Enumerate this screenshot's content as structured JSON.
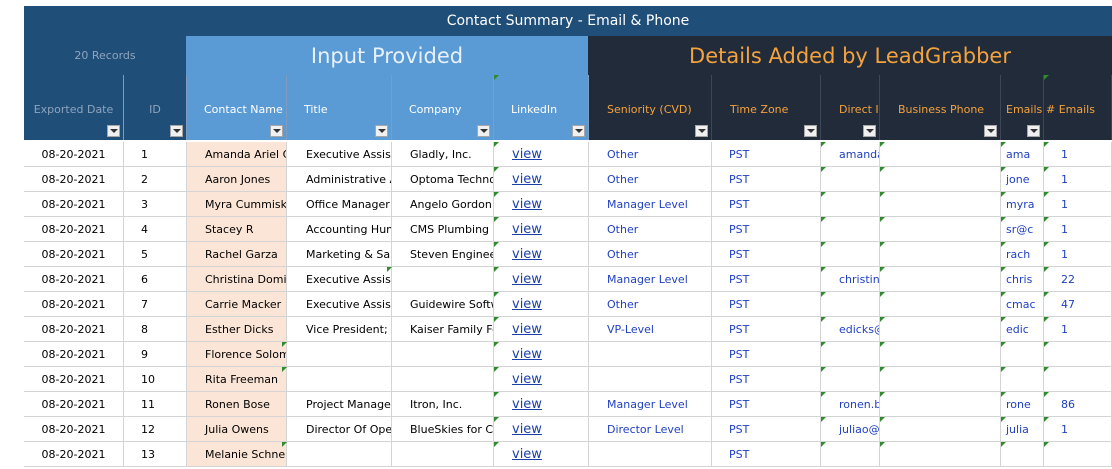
{
  "sheet": {
    "title": "Contact Summary - Email & Phone",
    "records_label": "20 Records",
    "input_band": "Input Provided",
    "details_band": "Details Added by LeadGrabber"
  },
  "columns": [
    "Exported Date",
    "ID",
    "Contact Name",
    "Title",
    "Company",
    "LinkedIn",
    "Seniority (CVD)",
    "Time Zone",
    "Direct I",
    "Business Phone",
    "Emails",
    "# Emails"
  ],
  "link_text": "view",
  "rows": [
    {
      "date": "08-20-2021",
      "id": "1",
      "name": "Amanda Ariel C",
      "title": "Executive Assist",
      "company": "Gladly, Inc.",
      "seniority": "Other",
      "tz": "PST",
      "direct": "amanda",
      "emails": "ama",
      "count": "1"
    },
    {
      "date": "08-20-2021",
      "id": "2",
      "name": "Aaron Jones",
      "title": "Administrative A",
      "company": "Optoma Techno",
      "seniority": "Other",
      "tz": "PST",
      "direct": "",
      "emails": "jone",
      "count": "1"
    },
    {
      "date": "08-20-2021",
      "id": "3",
      "name": "Myra Cummiske",
      "title": "Office Manager",
      "company": "Angelo Gordon",
      "seniority": "Manager Level",
      "tz": "PST",
      "direct": "",
      "emails": "myra",
      "count": "1"
    },
    {
      "date": "08-20-2021",
      "id": "4",
      "name": "Stacey R",
      "title": "Accounting Hum",
      "company": "CMS Plumbing",
      "seniority": "Other",
      "tz": "PST",
      "direct": "",
      "emails": "sr@c",
      "count": "1"
    },
    {
      "date": "08-20-2021",
      "id": "5",
      "name": "Rachel Garza",
      "title": "Marketing & Sal",
      "company": "Steven Enginee",
      "seniority": "Other",
      "tz": "PST",
      "direct": "",
      "emails": "rach",
      "count": "1"
    },
    {
      "date": "08-20-2021",
      "id": "6",
      "name": "Christina Domi",
      "title": "Executive Assist",
      "company": "",
      "seniority": "Manager Level",
      "tz": "PST",
      "direct": "christin",
      "emails": "chris",
      "count": "22"
    },
    {
      "date": "08-20-2021",
      "id": "7",
      "name": "Carrie Macker",
      "title": "Executive Assist",
      "company": "Guidewire Softw",
      "seniority": "Other",
      "tz": "PST",
      "direct": "",
      "emails": "cmac",
      "count": "47"
    },
    {
      "date": "08-20-2021",
      "id": "8",
      "name": "Esther Dicks",
      "title": "Vice President;",
      "company": "Kaiser Family Fo",
      "seniority": "VP-Level",
      "tz": "PST",
      "direct": "edicks@",
      "emails": "edic",
      "count": "1"
    },
    {
      "date": "08-20-2021",
      "id": "9",
      "name": "Florence Solom",
      "title": "",
      "company": "",
      "seniority": "",
      "tz": "PST",
      "direct": "",
      "emails": "",
      "count": ""
    },
    {
      "date": "08-20-2021",
      "id": "10",
      "name": "Rita Freeman",
      "title": "",
      "company": "",
      "seniority": "",
      "tz": "PST",
      "direct": "",
      "emails": "",
      "count": ""
    },
    {
      "date": "08-20-2021",
      "id": "11",
      "name": "Ronen Bose",
      "title": "Project Manager",
      "company": "Itron, Inc.",
      "seniority": "Manager Level",
      "tz": "PST",
      "direct": "ronen.b",
      "emails": "rone",
      "count": "86"
    },
    {
      "date": "08-20-2021",
      "id": "12",
      "name": "Julia Owens",
      "title": "Director Of Oper",
      "company": "BlueSkies for Ch",
      "seniority": "Director Level",
      "tz": "PST",
      "direct": "juliao@",
      "emails": "julia",
      "count": "1"
    },
    {
      "date": "08-20-2021",
      "id": "13",
      "name": "Melanie Schne",
      "title": "",
      "company": "",
      "seniority": "",
      "tz": "PST",
      "direct": "",
      "emails": "",
      "count": ""
    }
  ]
}
